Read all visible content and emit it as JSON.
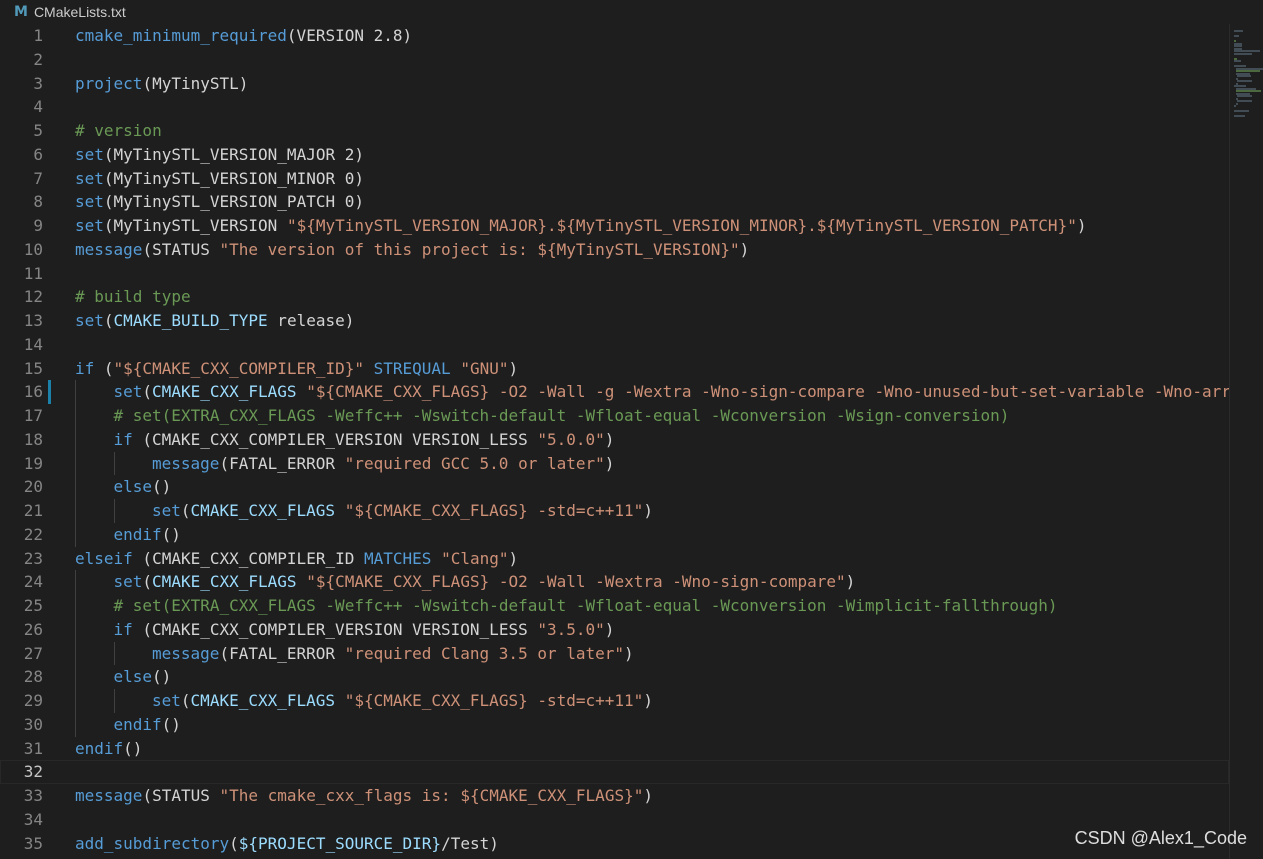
{
  "tab": {
    "icon": "cmake-file-icon",
    "icon_glyph": "M",
    "filename": "CMakeLists.txt"
  },
  "watermark": "CSDN @Alex1_Code",
  "current_line": 32,
  "modified_line": 16,
  "lines": [
    {
      "n": "1",
      "indent": 0,
      "tokens": [
        [
          "fn",
          "cmake_minimum_required"
        ],
        [
          "pl",
          "(VERSION 2.8)"
        ]
      ]
    },
    {
      "n": "2",
      "indent": 0,
      "tokens": []
    },
    {
      "n": "3",
      "indent": 0,
      "tokens": [
        [
          "fn",
          "project"
        ],
        [
          "pl",
          "(MyTinySTL)"
        ]
      ]
    },
    {
      "n": "4",
      "indent": 0,
      "tokens": []
    },
    {
      "n": "5",
      "indent": 0,
      "tokens": [
        [
          "cm",
          "# version"
        ]
      ]
    },
    {
      "n": "6",
      "indent": 0,
      "tokens": [
        [
          "fn",
          "set"
        ],
        [
          "pl",
          "(MyTinySTL_VERSION_MAJOR 2)"
        ]
      ]
    },
    {
      "n": "7",
      "indent": 0,
      "tokens": [
        [
          "fn",
          "set"
        ],
        [
          "pl",
          "(MyTinySTL_VERSION_MINOR 0)"
        ]
      ]
    },
    {
      "n": "8",
      "indent": 0,
      "tokens": [
        [
          "fn",
          "set"
        ],
        [
          "pl",
          "(MyTinySTL_VERSION_PATCH 0)"
        ]
      ]
    },
    {
      "n": "9",
      "indent": 0,
      "tokens": [
        [
          "fn",
          "set"
        ],
        [
          "pl",
          "(MyTinySTL_VERSION "
        ],
        [
          "str",
          "\"${MyTinySTL_VERSION_MAJOR}.${MyTinySTL_VERSION_MINOR}.${MyTinySTL_VERSION_PATCH}\""
        ],
        [
          "pl",
          ")"
        ]
      ]
    },
    {
      "n": "10",
      "indent": 0,
      "tokens": [
        [
          "fn",
          "message"
        ],
        [
          "pl",
          "(STATUS "
        ],
        [
          "str",
          "\"The version of this project is: ${MyTinySTL_VERSION}\""
        ],
        [
          "pl",
          ")"
        ]
      ]
    },
    {
      "n": "11",
      "indent": 0,
      "tokens": []
    },
    {
      "n": "12",
      "indent": 0,
      "tokens": [
        [
          "cm",
          "# build type"
        ]
      ]
    },
    {
      "n": "13",
      "indent": 0,
      "tokens": [
        [
          "fn",
          "set"
        ],
        [
          "pl",
          "("
        ],
        [
          "var",
          "CMAKE_BUILD_TYPE"
        ],
        [
          "pl",
          " release)"
        ]
      ]
    },
    {
      "n": "14",
      "indent": 0,
      "tokens": []
    },
    {
      "n": "15",
      "indent": 0,
      "tokens": [
        [
          "kw",
          "if"
        ],
        [
          "pl",
          " ("
        ],
        [
          "str",
          "\"${CMAKE_CXX_COMPILER_ID}\""
        ],
        [
          "pl",
          " "
        ],
        [
          "kw",
          "STREQUAL"
        ],
        [
          "pl",
          " "
        ],
        [
          "str",
          "\"GNU\""
        ],
        [
          "pl",
          ")"
        ]
      ]
    },
    {
      "n": "16",
      "indent": 1,
      "tokens": [
        [
          "fn",
          "set"
        ],
        [
          "pl",
          "("
        ],
        [
          "var",
          "CMAKE_CXX_FLAGS"
        ],
        [
          "pl",
          " "
        ],
        [
          "str",
          "\"${CMAKE_CXX_FLAGS} -O2 -Wall -g -Wextra -Wno-sign-compare -Wno-unused-but-set-variable -Wno-arr"
        ]
      ]
    },
    {
      "n": "17",
      "indent": 1,
      "tokens": [
        [
          "cm",
          "# set(EXTRA_CXX_FLAGS -Weffc++ -Wswitch-default -Wfloat-equal -Wconversion -Wsign-conversion)"
        ]
      ]
    },
    {
      "n": "18",
      "indent": 1,
      "tokens": [
        [
          "kw",
          "if"
        ],
        [
          "pl",
          " (CMAKE_CXX_COMPILER_VERSION VERSION_LESS "
        ],
        [
          "str",
          "\"5.0.0\""
        ],
        [
          "pl",
          ")"
        ]
      ]
    },
    {
      "n": "19",
      "indent": 2,
      "tokens": [
        [
          "fn",
          "message"
        ],
        [
          "pl",
          "(FATAL_ERROR "
        ],
        [
          "str",
          "\"required GCC 5.0 or later\""
        ],
        [
          "pl",
          ")"
        ]
      ]
    },
    {
      "n": "20",
      "indent": 1,
      "tokens": [
        [
          "kw",
          "else"
        ],
        [
          "pl",
          "()"
        ]
      ]
    },
    {
      "n": "21",
      "indent": 2,
      "tokens": [
        [
          "fn",
          "set"
        ],
        [
          "pl",
          "("
        ],
        [
          "var",
          "CMAKE_CXX_FLAGS"
        ],
        [
          "pl",
          " "
        ],
        [
          "str",
          "\"${CMAKE_CXX_FLAGS} -std=c++11\""
        ],
        [
          "pl",
          ")"
        ]
      ]
    },
    {
      "n": "22",
      "indent": 1,
      "tokens": [
        [
          "kw",
          "endif"
        ],
        [
          "pl",
          "()"
        ]
      ]
    },
    {
      "n": "23",
      "indent": 0,
      "tokens": [
        [
          "kw",
          "elseif"
        ],
        [
          "pl",
          " (CMAKE_CXX_COMPILER_ID "
        ],
        [
          "kw",
          "MATCHES"
        ],
        [
          "pl",
          " "
        ],
        [
          "str",
          "\"Clang\""
        ],
        [
          "pl",
          ")"
        ]
      ]
    },
    {
      "n": "24",
      "indent": 1,
      "tokens": [
        [
          "fn",
          "set"
        ],
        [
          "pl",
          "("
        ],
        [
          "var",
          "CMAKE_CXX_FLAGS"
        ],
        [
          "pl",
          " "
        ],
        [
          "str",
          "\"${CMAKE_CXX_FLAGS} -O2 -Wall -Wextra -Wno-sign-compare\""
        ],
        [
          "pl",
          ")"
        ]
      ]
    },
    {
      "n": "25",
      "indent": 1,
      "tokens": [
        [
          "cm",
          "# set(EXTRA_CXX_FLAGS -Weffc++ -Wswitch-default -Wfloat-equal -Wconversion -Wimplicit-fallthrough)"
        ]
      ]
    },
    {
      "n": "26",
      "indent": 1,
      "tokens": [
        [
          "kw",
          "if"
        ],
        [
          "pl",
          " (CMAKE_CXX_COMPILER_VERSION VERSION_LESS "
        ],
        [
          "str",
          "\"3.5.0\""
        ],
        [
          "pl",
          ")"
        ]
      ]
    },
    {
      "n": "27",
      "indent": 2,
      "tokens": [
        [
          "fn",
          "message"
        ],
        [
          "pl",
          "(FATAL_ERROR "
        ],
        [
          "str",
          "\"required Clang 3.5 or later\""
        ],
        [
          "pl",
          ")"
        ]
      ]
    },
    {
      "n": "28",
      "indent": 1,
      "tokens": [
        [
          "kw",
          "else"
        ],
        [
          "pl",
          "()"
        ]
      ]
    },
    {
      "n": "29",
      "indent": 2,
      "tokens": [
        [
          "fn",
          "set"
        ],
        [
          "pl",
          "("
        ],
        [
          "var",
          "CMAKE_CXX_FLAGS"
        ],
        [
          "pl",
          " "
        ],
        [
          "str",
          "\"${CMAKE_CXX_FLAGS} -std=c++11\""
        ],
        [
          "pl",
          ")"
        ]
      ]
    },
    {
      "n": "30",
      "indent": 1,
      "tokens": [
        [
          "kw",
          "endif"
        ],
        [
          "pl",
          "()"
        ]
      ]
    },
    {
      "n": "31",
      "indent": 0,
      "tokens": [
        [
          "kw",
          "endif"
        ],
        [
          "pl",
          "()"
        ]
      ]
    },
    {
      "n": "32",
      "indent": 0,
      "tokens": []
    },
    {
      "n": "33",
      "indent": 0,
      "tokens": [
        [
          "fn",
          "message"
        ],
        [
          "pl",
          "(STATUS "
        ],
        [
          "str",
          "\"The cmake_cxx_flags is: ${CMAKE_CXX_FLAGS}\""
        ],
        [
          "pl",
          ")"
        ]
      ]
    },
    {
      "n": "34",
      "indent": 0,
      "tokens": []
    },
    {
      "n": "35",
      "indent": 0,
      "tokens": [
        [
          "fn",
          "add_subdirectory"
        ],
        [
          "pl",
          "("
        ],
        [
          "var",
          "${PROJECT_SOURCE_DIR}"
        ],
        [
          "pl",
          "/Test)"
        ]
      ]
    }
  ],
  "colors": {
    "background": "#1e1e1e",
    "function": "#569cd6",
    "string": "#ce9178",
    "comment": "#6a9955",
    "variable": "#9cdcfe",
    "plain": "#d4d4d4",
    "line_number": "#858585",
    "modified_bar": "#1b81a8"
  }
}
